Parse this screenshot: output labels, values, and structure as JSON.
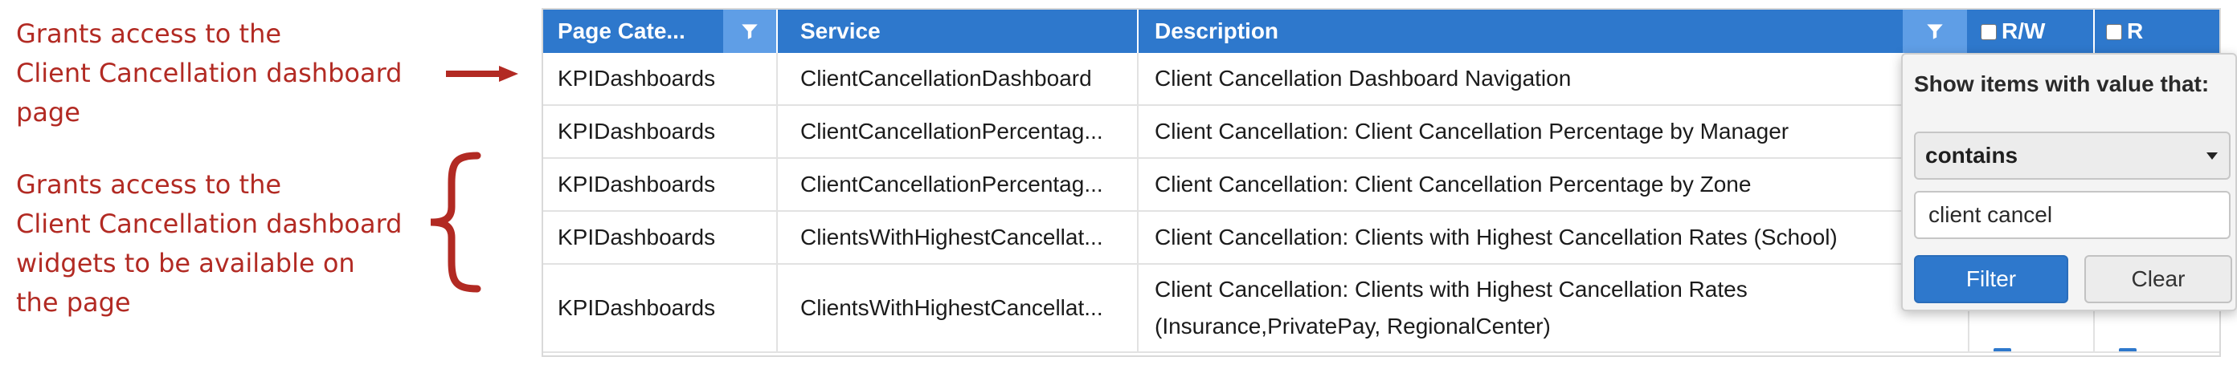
{
  "annotations": {
    "arrow_note": [
      "Grants access to the",
      "Client Cancellation dashboard",
      "page"
    ],
    "brace_note": [
      "Grants access to the",
      "Client Cancellation dashboard",
      "widgets to be available on",
      "the page"
    ],
    "color": "#b22a23"
  },
  "grid": {
    "columns": {
      "category": "Page Cate...",
      "service": "Service",
      "description": "Description",
      "read_write": "R/W",
      "read": "R"
    },
    "rows": [
      {
        "category": "KPIDashboards",
        "service": "ClientCancellationDashboard",
        "description": "Client Cancellation Dashboard Navigation"
      },
      {
        "category": "KPIDashboards",
        "service": "ClientCancellationPercentag...",
        "description": "Client Cancellation: Client Cancellation Percentage by Manager"
      },
      {
        "category": "KPIDashboards",
        "service": "ClientCancellationPercentag...",
        "description": "Client Cancellation: Client Cancellation Percentage by Zone"
      },
      {
        "category": "KPIDashboards",
        "service": "ClientsWithHighestCancellat...",
        "description": "Client Cancellation: Clients with Highest Cancellation Rates (School)"
      },
      {
        "category": "KPIDashboards",
        "service": "ClientsWithHighestCancellat...",
        "description": "Client Cancellation: Clients with Highest Cancellation Rates (Insurance,PrivatePay, RegionalCenter)"
      }
    ],
    "header_color": "#2e78cc",
    "filter_button_color": "#5f9ee6"
  },
  "filter_popup": {
    "title": "Show items with value that:",
    "operator": "contains",
    "value": "client cancel",
    "filter_label": "Filter",
    "clear_label": "Clear",
    "icons": [
      "filter-icon",
      "dropdown-caret-icon"
    ]
  }
}
